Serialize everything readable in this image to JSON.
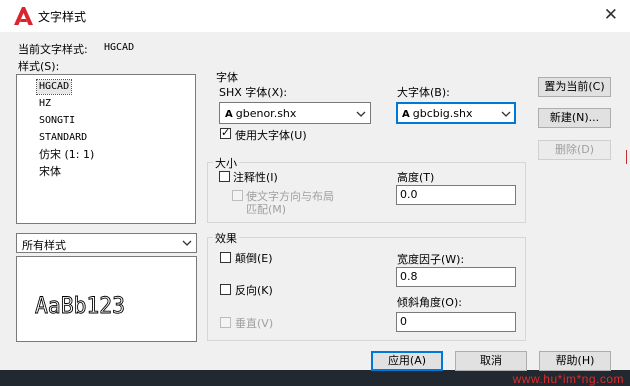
{
  "window": {
    "title": "文字样式",
    "close_glyph": "✕"
  },
  "current_style": {
    "label": "当前文字样式:",
    "value": "HGCAD"
  },
  "styles": {
    "label": "样式(S):",
    "items": [
      "HGCAD",
      "HZ",
      "SONGTI",
      "STANDARD",
      "仿宋 (1: 1)",
      "宋体"
    ],
    "selected": "HGCAD"
  },
  "filter": {
    "value": "所有样式"
  },
  "preview": {
    "text": "AaBb123"
  },
  "font_group": {
    "title": "字体",
    "shx_label": "SHX 字体(X):",
    "shx_value": "gbenor.shx",
    "big_label": "大字体(B):",
    "big_value": "gbcbig.shx",
    "use_big_label": "使用大字体(U)",
    "use_big_checked": true,
    "icon": "A"
  },
  "size_group": {
    "title": "大小",
    "annotative_label": "注释性(I)",
    "orient_label_1": "使文字方向与布局",
    "orient_label_2": "匹配(M)",
    "height_label": "高度(T)",
    "height_value": "0.0"
  },
  "effects_group": {
    "title": "效果",
    "upside_label": "颠倒(E)",
    "backwards_label": "反向(K)",
    "vertical_label": "垂直(V)",
    "width_label": "宽度因子(W):",
    "width_value": "0.8",
    "oblique_label": "倾斜角度(O):",
    "oblique_value": "0"
  },
  "buttons": {
    "set_current": "置为当前(C)",
    "new": "新建(N)...",
    "delete": "删除(D)",
    "apply": "应用(A)",
    "cancel": "取消",
    "help": "帮助(H)"
  },
  "watermark": "www.hu*im*ng.com",
  "colors": {
    "accent": "#0078d7",
    "logo_red": "#d8262e"
  }
}
